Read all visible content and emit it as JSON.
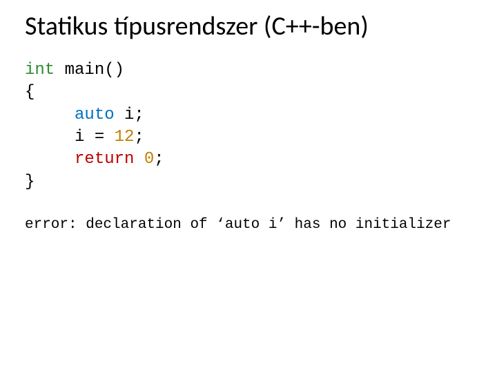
{
  "title": "Statikus típusrendszer (C++-ben)",
  "code": {
    "kw_int": "int",
    "main_sig": " main()",
    "brace_open": "{",
    "indent": "     ",
    "kw_auto": "auto",
    "decl_rest": " i;",
    "assign": "i = ",
    "num1": "12",
    "semi": ";",
    "kw_return": "return",
    "sp": " ",
    "num2": "0",
    "brace_close": "}"
  },
  "error_line": "error: declaration of ‘auto i’ has no initializer"
}
